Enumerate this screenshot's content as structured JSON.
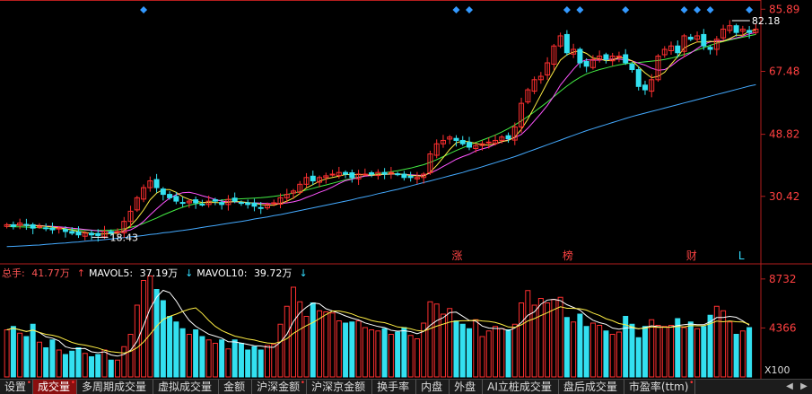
{
  "chart_data": [
    {
      "type": "candlestick",
      "title": "",
      "y_ticks": [
        "85.89",
        "67.48",
        "48.82",
        "30.42"
      ],
      "y_range": [
        12,
        86.5
      ],
      "high_label": "82.18",
      "low_label": "18.43",
      "series": {
        "close": [
          22,
          21.5,
          22.5,
          22,
          21,
          21.5,
          21,
          20.5,
          21,
          20,
          19.5,
          19,
          19.5,
          19,
          18.8,
          20,
          19.5,
          20,
          23,
          26,
          30,
          33,
          35,
          33,
          31,
          30,
          29,
          28.5,
          29,
          28.5,
          28,
          29,
          29,
          28,
          29.5,
          29,
          28.5,
          28,
          27.5,
          27,
          28,
          28.5,
          30,
          31,
          32,
          34,
          36,
          35,
          36,
          36.5,
          37,
          37.5,
          37,
          36,
          37,
          37,
          37,
          37.5,
          37,
          37.5,
          37,
          36,
          36,
          36,
          37,
          43,
          46,
          47,
          48,
          47,
          46,
          45,
          45.5,
          46,
          46.5,
          47,
          48,
          47.5,
          51,
          58,
          62,
          65,
          66,
          70,
          75,
          78,
          73,
          74,
          70,
          69,
          71,
          72,
          71,
          72,
          72,
          70,
          68,
          63,
          62,
          65,
          72,
          74,
          75,
          73,
          78,
          77,
          78,
          75,
          74,
          77,
          80,
          81,
          79,
          80,
          79,
          80
        ],
        "ma5": [
          22,
          21.8,
          21.9,
          21.8,
          21.8,
          21.7,
          21.5,
          21.3,
          21.1,
          20.8,
          20.4,
          20.0,
          19.8,
          19.4,
          19.2,
          19.3,
          19.4,
          19.5,
          20.3,
          21.7,
          23.8,
          26.4,
          29.4,
          31.4,
          32.4,
          32.4,
          31.6,
          30.3,
          29.5,
          29.0,
          28.6,
          28.6,
          28.6,
          28.5,
          28.7,
          28.9,
          28.8,
          28.6,
          28.4,
          28.0,
          27.8,
          27.8,
          28.3,
          29.0,
          29.9,
          31.3,
          32.9,
          33.9,
          34.9,
          35.6,
          36.0,
          36.4,
          36.9,
          36.8,
          36.9,
          36.8,
          36.7,
          36.8,
          36.9,
          37.1,
          37.1,
          36.9,
          36.6,
          36.5,
          36.4,
          37.6,
          39.6,
          41.9,
          44.3,
          46.3,
          46.8,
          46.6,
          46.1,
          45.7,
          45.6,
          46.0,
          46.7,
          47.0,
          48.0,
          50.3,
          53.3,
          56.9,
          60.5,
          64.2,
          67.6,
          70.8,
          72.4,
          73.2,
          73.6,
          72.8,
          71.4,
          71.2,
          70.6,
          70.8,
          71.6,
          71.4,
          70.6,
          68.8,
          67.0,
          65.6,
          66.0,
          67.2,
          69.6,
          71.8,
          74.4,
          75.4,
          76.2,
          76.2,
          76.4,
          76.2,
          76.4,
          77.2,
          78.2,
          78.2,
          79.4,
          79.8
        ],
        "ma10": [
          22,
          21.9,
          21.9,
          21.8,
          21.8,
          21.8,
          21.6,
          21.5,
          21.4,
          21.2,
          21.0,
          20.8,
          20.6,
          20.4,
          20.2,
          20.0,
          19.9,
          19.8,
          20.0,
          20.5,
          21.5,
          23.0,
          24.9,
          26.7,
          28.4,
          29.9,
          30.9,
          31.5,
          31.6,
          31.2,
          30.6,
          30.1,
          29.5,
          29.0,
          28.8,
          28.8,
          28.7,
          28.5,
          28.5,
          28.4,
          28.3,
          28.2,
          28.3,
          28.5,
          28.8,
          29.3,
          30.1,
          30.8,
          31.6,
          32.3,
          33.2,
          34.2,
          35.1,
          35.5,
          36.0,
          36.4,
          36.6,
          36.8,
          36.9,
          37.0,
          37.0,
          36.9,
          36.8,
          36.7,
          36.6,
          37.3,
          38.2,
          39.3,
          40.3,
          41.4,
          42.2,
          42.9,
          43.9,
          44.5,
          45.0,
          45.9,
          46.6,
          47.2,
          47.8,
          48.8,
          50.6,
          52.8,
          55.0,
          57.4,
          60.2,
          63.4,
          65.8,
          68.1,
          70.2,
          70.9,
          70.8,
          70.8,
          71.0,
          71.1,
          71.1,
          70.9,
          70.6,
          69.9,
          69.3,
          68.4,
          67.8,
          68.0,
          69.1,
          70.6,
          71.8,
          72.9,
          74.2,
          75.5,
          76.2,
          76.5,
          76.6,
          77.0,
          77.4,
          77.9,
          78.6,
          79.0
        ],
        "ma20": [
          21.5,
          21.4,
          21.4,
          21.3,
          21.2,
          21.1,
          21.0,
          20.9,
          20.8,
          20.7,
          20.6,
          20.5,
          20.4,
          20.3,
          20.3,
          20.3,
          20.4,
          20.5,
          20.8,
          21.2,
          21.7,
          22.4,
          23.2,
          24.0,
          24.9,
          25.7,
          26.5,
          27.2,
          27.8,
          28.2,
          28.5,
          28.8,
          29.1,
          29.3,
          29.5,
          29.6,
          29.7,
          29.8,
          29.9,
          30.0,
          30.2,
          30.4,
          30.7,
          31.0,
          31.4,
          31.8,
          32.3,
          32.8,
          33.3,
          33.8,
          34.3,
          34.8,
          35.3,
          35.7,
          36.1,
          36.5,
          36.8,
          37.1,
          37.4,
          37.7,
          38.0,
          38.4,
          38.8,
          39.3,
          39.8,
          40.5,
          41.3,
          42.2,
          43.1,
          44.0,
          44.8,
          45.6,
          46.4,
          47.1,
          47.8,
          48.6,
          49.5,
          50.5,
          51.6,
          52.8,
          54.1,
          55.5,
          56.9,
          58.4,
          60.0,
          61.6,
          63.1,
          64.5,
          65.7,
          66.7,
          67.4,
          68.0,
          68.5,
          69.0,
          69.4,
          69.7,
          70.0,
          70.1,
          70.3,
          70.5,
          70.7,
          71.0,
          71.4,
          71.9,
          72.5,
          73.1,
          73.8,
          74.5,
          75.2,
          75.8,
          76.3,
          76.8,
          77.2,
          77.6,
          78.0,
          78.4
        ],
        "ma60": [
          15.5,
          15.6,
          15.7,
          15.8,
          15.9,
          16.0,
          16.2,
          16.3,
          16.5,
          16.6,
          16.8,
          16.9,
          17.1,
          17.3,
          17.4,
          17.6,
          17.8,
          18.0,
          18.2,
          18.4,
          18.6,
          18.8,
          19.1,
          19.3,
          19.6,
          19.8,
          20.1,
          20.3,
          20.6,
          20.9,
          21.2,
          21.5,
          21.8,
          22.1,
          22.4,
          22.7,
          23.0,
          23.3,
          23.7,
          24.0,
          24.3,
          24.7,
          25.0,
          25.4,
          25.8,
          26.2,
          26.6,
          27.0,
          27.4,
          27.8,
          28.2,
          28.6,
          29.0,
          29.4,
          29.9,
          30.3,
          30.7,
          31.2,
          31.6,
          32.1,
          32.5,
          33.0,
          33.5,
          34.0,
          34.5,
          35.0,
          35.5,
          36.0,
          36.5,
          37.0,
          37.5,
          38.1,
          38.6,
          39.2,
          39.8,
          40.4,
          41.0,
          41.6,
          42.2,
          42.9,
          43.6,
          44.3,
          45.0,
          45.7,
          46.4,
          47.1,
          47.8,
          48.5,
          49.2,
          49.9,
          50.5,
          51.1,
          51.7,
          52.3,
          52.9,
          53.5,
          54.1,
          54.6,
          55.1,
          55.6,
          56.1,
          56.6,
          57.1,
          57.6,
          58.1,
          58.6,
          59.1,
          59.6,
          60.1,
          60.6,
          61.1,
          61.6,
          62.1,
          62.6,
          63.1,
          63.5
        ]
      },
      "event_markers": [
        {
          "index": 69,
          "label": "涨"
        },
        {
          "index": 86,
          "label": "榜"
        },
        {
          "index": 105,
          "label": "财"
        },
        {
          "index": 113,
          "label": "L"
        }
      ],
      "top_marker_indices": [
        21,
        69,
        71,
        86,
        88,
        95,
        104,
        106,
        108,
        114
      ],
      "colors": {
        "up": "#ff3030",
        "down": "#33e0f0",
        "ma5": "#ffffff",
        "ma10": "#ffee44",
        "ma20": "#ff55ff",
        "ma30": "#44ee44",
        "ma60": "#44aaff",
        "axis": "#b41e1e",
        "tick": "#ff4040",
        "marker": "#3399ff"
      }
    },
    {
      "type": "bar",
      "title": "",
      "y_ticks": [
        "8732",
        "4366"
      ],
      "unit_label": "X100",
      "y_range": [
        0,
        9200
      ],
      "volume": [
        4200,
        4500,
        3900,
        3600,
        4700,
        3100,
        2600,
        3300,
        2400,
        2000,
        2300,
        2600,
        2100,
        1800,
        2000,
        2400,
        1500,
        1500,
        2700,
        3800,
        6400,
        8600,
        9000,
        7800,
        6800,
        5400,
        4900,
        4300,
        3800,
        4200,
        3600,
        3300,
        3000,
        3300,
        2500,
        3300,
        3000,
        2400,
        2700,
        2400,
        2800,
        2900,
        4700,
        6300,
        8000,
        6700,
        5400,
        6600,
        5900,
        5800,
        5700,
        5000,
        4800,
        4900,
        5000,
        4400,
        4200,
        4100,
        4300,
        3800,
        4000,
        4400,
        3700,
        3400,
        4800,
        6700,
        6500,
        5600,
        6100,
        5000,
        4700,
        4300,
        5100,
        3600,
        4100,
        4500,
        4300,
        4200,
        4700,
        6600,
        7700,
        6400,
        7000,
        6600,
        6900,
        7100,
        5300,
        4900,
        5600,
        4500,
        4800,
        4600,
        4100,
        3800,
        4000,
        5400,
        4700,
        3500,
        4500,
        5100,
        4600,
        4500,
        4600,
        5200,
        4400,
        4900,
        4300,
        4500,
        5500,
        6300,
        5900,
        4900,
        3800,
        4100,
        4400
      ],
      "ma5": [
        4200,
        4350,
        4200,
        4050,
        4180,
        3960,
        3580,
        3460,
        3220,
        2700,
        2540,
        2520,
        2540,
        2240,
        2160,
        2240,
        1960,
        1860,
        2020,
        2380,
        3180,
        4600,
        6100,
        7120,
        7720,
        7520,
        6780,
        5840,
        5040,
        4520,
        4160,
        3820,
        3640,
        3460,
        3140,
        3120,
        3020,
        2900,
        2780,
        2760,
        2660,
        2640,
        3100,
        3820,
        4940,
        5720,
        6220,
        6600,
        6520,
        6080,
        5880,
        5680,
        5440,
        5240,
        5080,
        4820,
        4660,
        4500,
        4400,
        4160,
        4080,
        4120,
        4040,
        3860,
        4060,
        4600,
        5020,
        5280,
        5740,
        5780,
        5420,
        5040,
        4980,
        4540,
        4360,
        4320,
        4320,
        4140,
        4360,
        4860,
        5500,
        5800,
        6480,
        6860,
        6920,
        6800,
        6440,
        6200,
        5960,
        5460,
        5060,
        4840,
        4700,
        4360,
        4260,
        4360,
        4400,
        4280,
        4420,
        4560,
        4480,
        4440,
        4460,
        4580,
        4660,
        4720,
        4660,
        4660,
        4920,
        5300,
        5300,
        5400,
        5320,
        5000,
        4620
      ],
      "ma10": [
        4200,
        4350,
        4200,
        4050,
        4180,
        3980,
        3800,
        3720,
        3570,
        3330,
        3080,
        2920,
        2840,
        2710,
        2580,
        2380,
        2250,
        2190,
        2130,
        2280,
        2600,
        3120,
        3810,
        4530,
        5120,
        5400,
        5600,
        5840,
        6040,
        6160,
        5660,
        5040,
        4510,
        4140,
        3880,
        3640,
        3520,
        3380,
        3290,
        3140,
        3030,
        2980,
        3140,
        3420,
        3890,
        4240,
        4580,
        4860,
        5190,
        5560,
        5880,
        5880,
        5770,
        5620,
        5380,
        5230,
        5030,
        4910,
        4840,
        4660,
        4460,
        4400,
        4290,
        4140,
        4080,
        4310,
        4530,
        4710,
        4890,
        4980,
        5010,
        5010,
        5070,
        4990,
        4950,
        4860,
        4680,
        4460,
        4420,
        4650,
        4990,
        5200,
        5470,
        5730,
        6010,
        6260,
        6120,
        6110,
        6080,
        5960,
        5700,
        5490,
        5190,
        5010,
        4760,
        4660,
        4450,
        4300,
        4350,
        4460,
        4420,
        4440,
        4430,
        4500,
        4460,
        4580,
        4560,
        4560,
        4750,
        4980,
        4920,
        4990,
        4920,
        4900,
        4690
      ],
      "legend": {
        "total_label": "总手:",
        "total_value": "41.77万",
        "ma5_label": "MAVOL5:",
        "ma5_value": "37.19万",
        "ma10_label": "MAVOL10:",
        "ma10_value": "39.72万",
        "ma5_arrow": "↑",
        "ma10_arrow": "↓",
        "total_arrow": "↓"
      }
    }
  ],
  "tabs": [
    {
      "label": "设置",
      "dot": true,
      "active": false
    },
    {
      "label": "成交量",
      "dot": true,
      "active": true
    },
    {
      "label": "多周期成交量",
      "dot": false,
      "active": false
    },
    {
      "label": "虚拟成交量",
      "dot": false,
      "active": false
    },
    {
      "label": "金额",
      "dot": false,
      "active": false
    },
    {
      "label": "沪深金额",
      "dot": true,
      "active": false
    },
    {
      "label": "沪深京金额",
      "dot": false,
      "active": false
    },
    {
      "label": "换手率",
      "dot": false,
      "active": false
    },
    {
      "label": "内盘",
      "dot": false,
      "active": false
    },
    {
      "label": "外盘",
      "dot": false,
      "active": false
    },
    {
      "label": "AI立桩成交量",
      "dot": false,
      "active": false
    },
    {
      "label": "盘后成交量",
      "dot": false,
      "active": false
    },
    {
      "label": "市盈率(ttm)",
      "dot": true,
      "active": false
    }
  ],
  "tab_arrows": [
    "◀",
    "▶"
  ]
}
